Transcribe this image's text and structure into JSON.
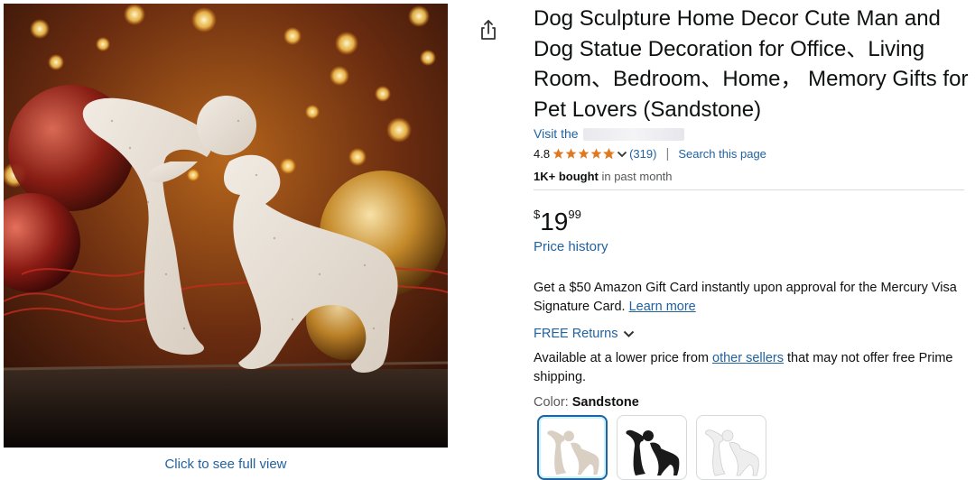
{
  "product": {
    "title": "Dog Sculpture Home Decor Cute Man and Dog Statue Decoration for Office、Living Room、Bedroom、Home， Memory Gifts for Pet Lovers (Sandstone)",
    "visit_label": "Visit the",
    "rating_value": "4.8",
    "rating_count": "(319)",
    "star_fill": 0.96,
    "search_page": "Search this page",
    "bought_bold": "1K+ bought",
    "bought_rest": " in past month"
  },
  "price": {
    "symbol": "$",
    "whole": "19",
    "fraction": "99",
    "history_label": "Price history"
  },
  "offer": {
    "text": "Get a $50 Amazon Gift Card instantly upon approval for the Mercury Visa Signature Card.",
    "learn_more": "Learn more"
  },
  "returns": {
    "label": "FREE Returns"
  },
  "lower_price": {
    "pre": "Available at a lower price from ",
    "link": "other sellers",
    "post": " that may not offer free Prime shipping."
  },
  "color": {
    "label": "Color: ",
    "selected": "Sandstone",
    "swatches": [
      {
        "name": "sandstone",
        "fill": "#d9cfc3"
      },
      {
        "name": "black",
        "fill": "#1a1a1a"
      },
      {
        "name": "white",
        "fill": "#f2f2f2"
      }
    ]
  },
  "image": {
    "full_view_label": "Click to see full view"
  },
  "colors": {
    "link": "#2162a1",
    "star": "#de7921",
    "text": "#0f1111"
  }
}
